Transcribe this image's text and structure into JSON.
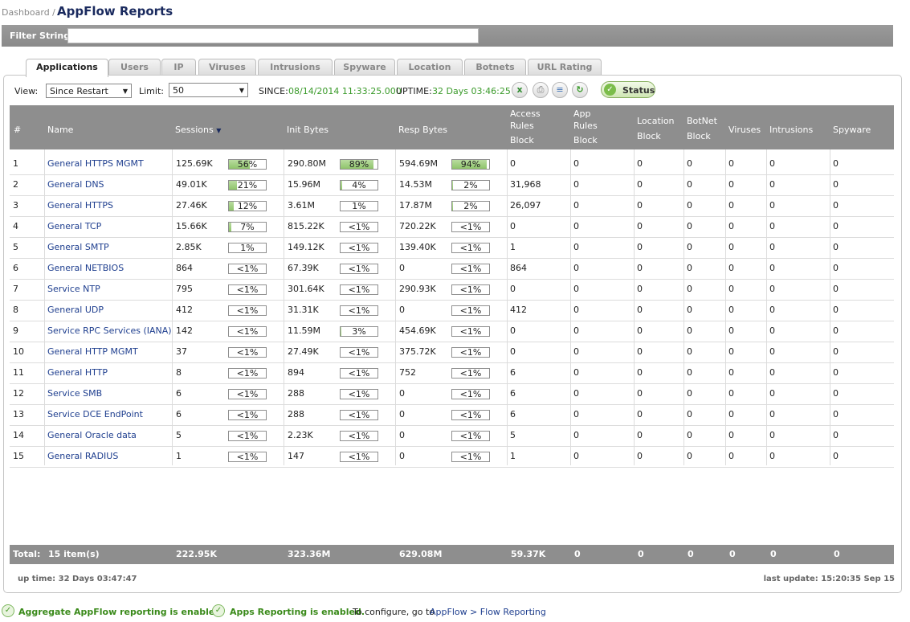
{
  "header": {
    "breadcrumb": "Dashboard /",
    "title": "AppFlow Reports"
  },
  "filter": {
    "label": "Filter String:",
    "value": ""
  },
  "tabs": [
    "Applications",
    "Users",
    "IP",
    "Viruses",
    "Intrusions",
    "Spyware",
    "Location",
    "Botnets",
    "URL Rating"
  ],
  "active_tab": "Applications",
  "toolbar": {
    "view_label": "View:",
    "view_value": "Since Restart",
    "limit_label": "Limit:",
    "limit_value": "50",
    "since_label": "SINCE:",
    "since_value": "08/14/2014 11:33:25.000",
    "uptime_label": "UPTIME:",
    "uptime_value": "32 Days 03:46:25",
    "icons": [
      "excel-export-icon",
      "print-icon",
      "report-icon",
      "refresh-icon"
    ],
    "status_label": "Status"
  },
  "table": {
    "headers": {
      "num": "#",
      "name": "Name",
      "sessions": "Sessions",
      "init": "Init Bytes",
      "resp": "Resp Bytes",
      "access_1": "Access",
      "access_2": "Rules",
      "access_3": "Block",
      "app_1": "App",
      "app_2": "Rules",
      "app_3": "Block",
      "loc_1": "Location",
      "loc_2": "Block",
      "bot_1": "BotNet",
      "bot_2": "Block",
      "viruses": "Viruses",
      "intrusions": "Intrusions",
      "spyware": "Spyware"
    },
    "rows": [
      {
        "n": "1",
        "name": "General HTTPS MGMT",
        "s": "125.69K",
        "sp": "56%",
        "sf": 0.56,
        "i": "290.80M",
        "ip": "89%",
        "if": 0.89,
        "r": "594.69M",
        "rp": "94%",
        "rf": 0.94,
        "ar": "0",
        "app": "0",
        "loc": "0",
        "bot": "0",
        "vir": "0",
        "intr": "0",
        "spy": "0"
      },
      {
        "n": "2",
        "name": "General DNS",
        "s": "49.01K",
        "sp": "21%",
        "sf": 0.21,
        "i": "15.96M",
        "ip": "4%",
        "if": 0.04,
        "r": "14.53M",
        "rp": "2%",
        "rf": 0.02,
        "ar": "31,968",
        "app": "0",
        "loc": "0",
        "bot": "0",
        "vir": "0",
        "intr": "0",
        "spy": "0"
      },
      {
        "n": "3",
        "name": "General HTTPS",
        "s": "27.46K",
        "sp": "12%",
        "sf": 0.12,
        "i": "3.61M",
        "ip": "1%",
        "if": 0.01,
        "r": "17.87M",
        "rp": "2%",
        "rf": 0.02,
        "ar": "26,097",
        "app": "0",
        "loc": "0",
        "bot": "0",
        "vir": "0",
        "intr": "0",
        "spy": "0"
      },
      {
        "n": "4",
        "name": "General TCP",
        "s": "15.66K",
        "sp": "7%",
        "sf": 0.07,
        "i": "815.22K",
        "ip": "<1%",
        "if": 0,
        "r": "720.22K",
        "rp": "<1%",
        "rf": 0,
        "ar": "0",
        "app": "0",
        "loc": "0",
        "bot": "0",
        "vir": "0",
        "intr": "0",
        "spy": "0"
      },
      {
        "n": "5",
        "name": "General SMTP",
        "s": "2.85K",
        "sp": "1%",
        "sf": 0.01,
        "i": "149.12K",
        "ip": "<1%",
        "if": 0,
        "r": "139.40K",
        "rp": "<1%",
        "rf": 0,
        "ar": "1",
        "app": "0",
        "loc": "0",
        "bot": "0",
        "vir": "0",
        "intr": "0",
        "spy": "0"
      },
      {
        "n": "6",
        "name": "General NETBIOS",
        "s": "864",
        "sp": "<1%",
        "sf": 0,
        "i": "67.39K",
        "ip": "<1%",
        "if": 0,
        "r": "0",
        "rp": "<1%",
        "rf": 0,
        "ar": "864",
        "app": "0",
        "loc": "0",
        "bot": "0",
        "vir": "0",
        "intr": "0",
        "spy": "0"
      },
      {
        "n": "7",
        "name": "Service NTP",
        "s": "795",
        "sp": "<1%",
        "sf": 0,
        "i": "301.64K",
        "ip": "<1%",
        "if": 0,
        "r": "290.93K",
        "rp": "<1%",
        "rf": 0,
        "ar": "0",
        "app": "0",
        "loc": "0",
        "bot": "0",
        "vir": "0",
        "intr": "0",
        "spy": "0"
      },
      {
        "n": "8",
        "name": "General UDP",
        "s": "412",
        "sp": "<1%",
        "sf": 0,
        "i": "31.31K",
        "ip": "<1%",
        "if": 0,
        "r": "0",
        "rp": "<1%",
        "rf": 0,
        "ar": "412",
        "app": "0",
        "loc": "0",
        "bot": "0",
        "vir": "0",
        "intr": "0",
        "spy": "0"
      },
      {
        "n": "9",
        "name": "Service RPC Services (IANA)",
        "s": "142",
        "sp": "<1%",
        "sf": 0,
        "i": "11.59M",
        "ip": "3%",
        "if": 0.03,
        "r": "454.69K",
        "rp": "<1%",
        "rf": 0,
        "ar": "0",
        "app": "0",
        "loc": "0",
        "bot": "0",
        "vir": "0",
        "intr": "0",
        "spy": "0"
      },
      {
        "n": "10",
        "name": "General HTTP MGMT",
        "s": "37",
        "sp": "<1%",
        "sf": 0,
        "i": "27.49K",
        "ip": "<1%",
        "if": 0,
        "r": "375.72K",
        "rp": "<1%",
        "rf": 0,
        "ar": "0",
        "app": "0",
        "loc": "0",
        "bot": "0",
        "vir": "0",
        "intr": "0",
        "spy": "0"
      },
      {
        "n": "11",
        "name": "General HTTP",
        "s": "8",
        "sp": "<1%",
        "sf": 0,
        "i": "894",
        "ip": "<1%",
        "if": 0,
        "r": "752",
        "rp": "<1%",
        "rf": 0,
        "ar": "6",
        "app": "0",
        "loc": "0",
        "bot": "0",
        "vir": "0",
        "intr": "0",
        "spy": "0"
      },
      {
        "n": "12",
        "name": "Service SMB",
        "s": "6",
        "sp": "<1%",
        "sf": 0,
        "i": "288",
        "ip": "<1%",
        "if": 0,
        "r": "0",
        "rp": "<1%",
        "rf": 0,
        "ar": "6",
        "app": "0",
        "loc": "0",
        "bot": "0",
        "vir": "0",
        "intr": "0",
        "spy": "0"
      },
      {
        "n": "13",
        "name": "Service DCE EndPoint",
        "s": "6",
        "sp": "<1%",
        "sf": 0,
        "i": "288",
        "ip": "<1%",
        "if": 0,
        "r": "0",
        "rp": "<1%",
        "rf": 0,
        "ar": "6",
        "app": "0",
        "loc": "0",
        "bot": "0",
        "vir": "0",
        "intr": "0",
        "spy": "0"
      },
      {
        "n": "14",
        "name": "General Oracle data",
        "s": "5",
        "sp": "<1%",
        "sf": 0,
        "i": "2.23K",
        "ip": "<1%",
        "if": 0,
        "r": "0",
        "rp": "<1%",
        "rf": 0,
        "ar": "5",
        "app": "0",
        "loc": "0",
        "bot": "0",
        "vir": "0",
        "intr": "0",
        "spy": "0"
      },
      {
        "n": "15",
        "name": "General RADIUS",
        "s": "1",
        "sp": "<1%",
        "sf": 0,
        "i": "147",
        "ip": "<1%",
        "if": 0,
        "r": "0",
        "rp": "<1%",
        "rf": 0,
        "ar": "1",
        "app": "0",
        "loc": "0",
        "bot": "0",
        "vir": "0",
        "intr": "0",
        "spy": "0"
      }
    ],
    "total": {
      "label": "Total:",
      "items": "15 item(s)",
      "sessions": "222.95K",
      "init": "323.36M",
      "resp": "629.08M",
      "access": "59.37K",
      "app": "0",
      "loc": "0",
      "bot": "0",
      "vir": "0",
      "intr": "0",
      "spy": "0"
    }
  },
  "footer": {
    "uptime": "up time: 32 Days 03:47:47",
    "last_update": "last update: 15:20:35 Sep 15"
  },
  "notes": {
    "aggregate": "Aggregate AppFlow reporting is enabled.",
    "apps": "Apps Reporting is enabled.",
    "configure": "To configure, go to",
    "link": "AppFlow > Flow Reporting",
    "period": "."
  },
  "colors": {
    "header_bg": "#8e8e8e",
    "bar_fill": "#8fc46b",
    "link": "#1f3f8f",
    "enabled_green": "#3a8a1a"
  }
}
